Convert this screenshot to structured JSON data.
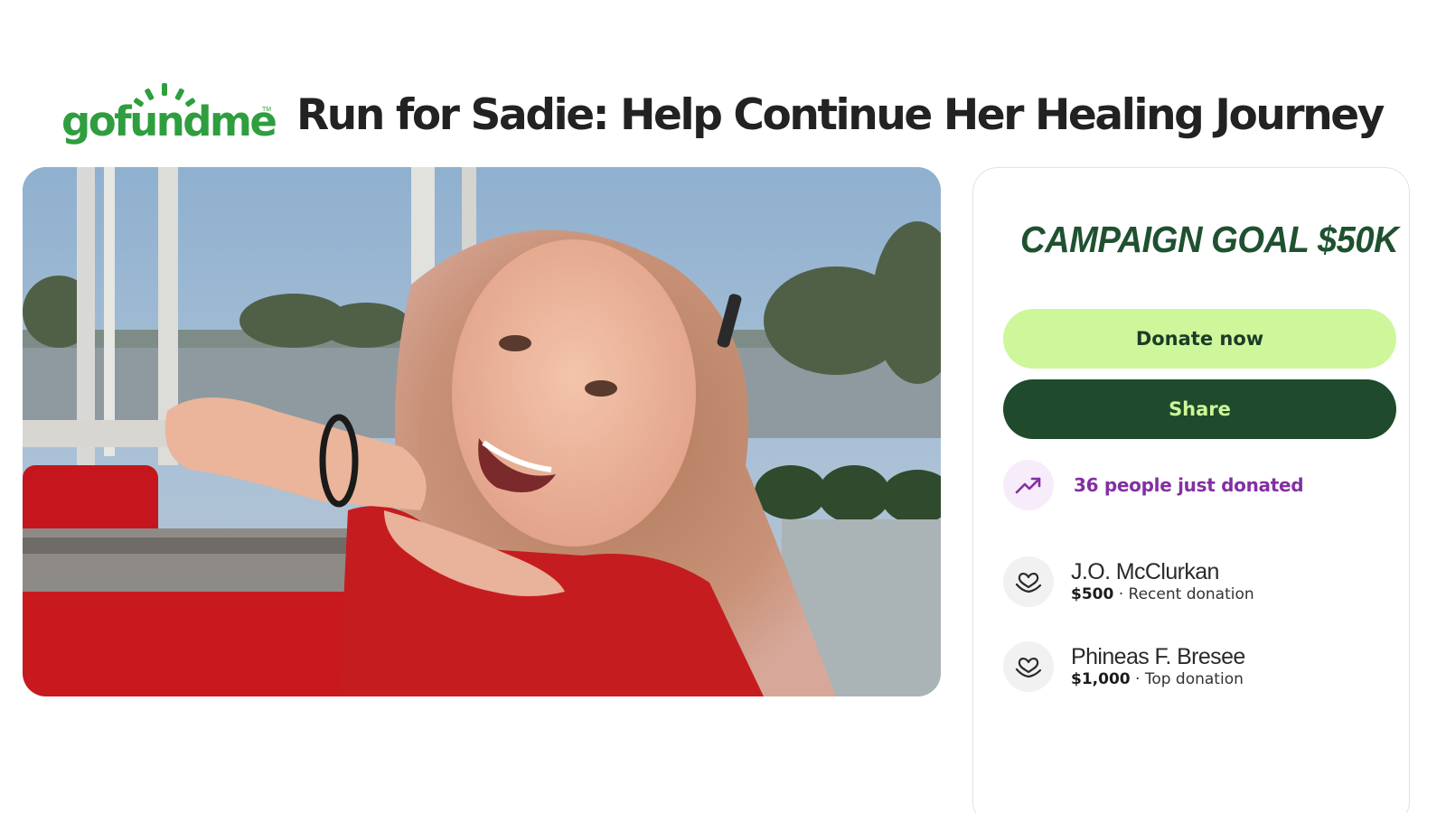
{
  "brand": {
    "name": "gofundme",
    "trademark": "TM",
    "color": "#2e9e3e"
  },
  "page": {
    "title": "Run for Sadie: Help Continue Her Healing Journey"
  },
  "campaign": {
    "goal_text": "CAMPAIGN GOAL $50K",
    "donate_label": "Donate now",
    "share_label": "Share",
    "activity_text": "36 people just donated",
    "activity_icon": "trending-up-icon",
    "colors": {
      "donate_bg": "#cdf79a",
      "share_bg": "#1f4a2c",
      "activity": "#842fa3",
      "goal": "#1f5130"
    }
  },
  "donations": [
    {
      "name": "J.O. McClurkan",
      "amount": "$500",
      "separator": " · ",
      "label": "Recent donation",
      "icon": "heart-hand-icon"
    },
    {
      "name": "Phineas F. Bresee",
      "amount": "$1,000",
      "separator": " · ",
      "label": "Top donation",
      "icon": "heart-hand-icon"
    }
  ]
}
